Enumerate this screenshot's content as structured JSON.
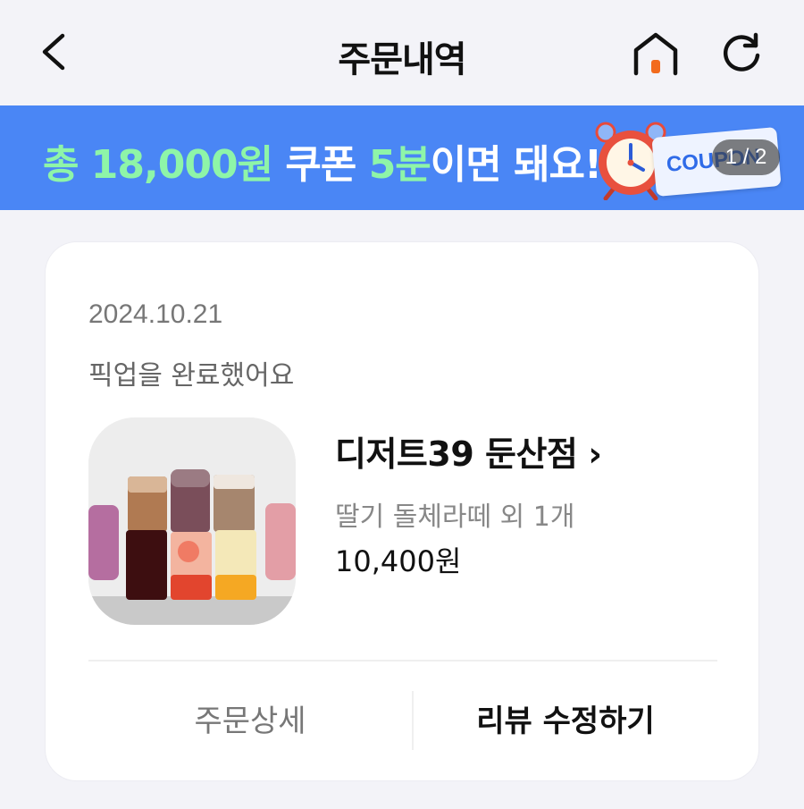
{
  "header": {
    "title": "주문내역",
    "back_icon": "chevron-left-icon",
    "home_icon": "home-icon",
    "refresh_icon": "refresh-icon"
  },
  "banner": {
    "text_part1": "총 18,000원",
    "text_part2": " 쿠폰 ",
    "text_part3": "5분",
    "text_part4": "이면 돼요!",
    "coupon_word": "COUPON",
    "pager": "1 / 2",
    "background_color": "#4a86f5",
    "highlight_color": "#8ef5a8"
  },
  "order": {
    "date": "2024.10.21",
    "status": "픽업을 완료했어요",
    "store_name": "디저트39 둔산점",
    "store_chevron": "›",
    "items": "딸기 돌체라떼 외 1개",
    "price": "10,400원",
    "detail_label": "주문상세",
    "review_label": "리뷰 수정하기"
  }
}
